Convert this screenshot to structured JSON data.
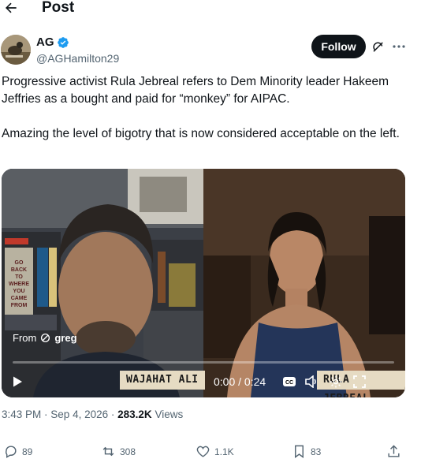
{
  "header": {
    "title": "Post",
    "back_icon": "arrow-left-icon"
  },
  "author": {
    "name": "AG",
    "handle": "@AGHamilton29",
    "verified": true,
    "follow_label": "Follow"
  },
  "tweet": {
    "paragraphs": [
      "Progressive activist Rula Jebreal refers to Dem Minority leader Hakeem Jeffries as a bought and paid for “monkey” for AIPAC.",
      "Amazing the level of bigotry that is now considered acceptable on the left."
    ]
  },
  "video": {
    "from_prefix": "From",
    "from_account": "greg",
    "left_nameplate": "WAJAHAT ALI",
    "right_nameplate": "RULA JEBREAL",
    "book_text": "GO BACK TO WHERE YOU CAME FROM",
    "time": "0:00 / 0:24",
    "progress": 0.0
  },
  "meta": {
    "time": "3:43 PM",
    "date": "Sep 4, 2026",
    "views_count": "283.2K",
    "views_label": "Views"
  },
  "actions": {
    "replies": "89",
    "reposts": "308",
    "likes": "1.1K",
    "bookmarks": "83"
  },
  "colors": {
    "text": "#0f1419",
    "muted": "#536471",
    "verified": "#1d9bf0",
    "follow_bg": "#0f1419"
  }
}
